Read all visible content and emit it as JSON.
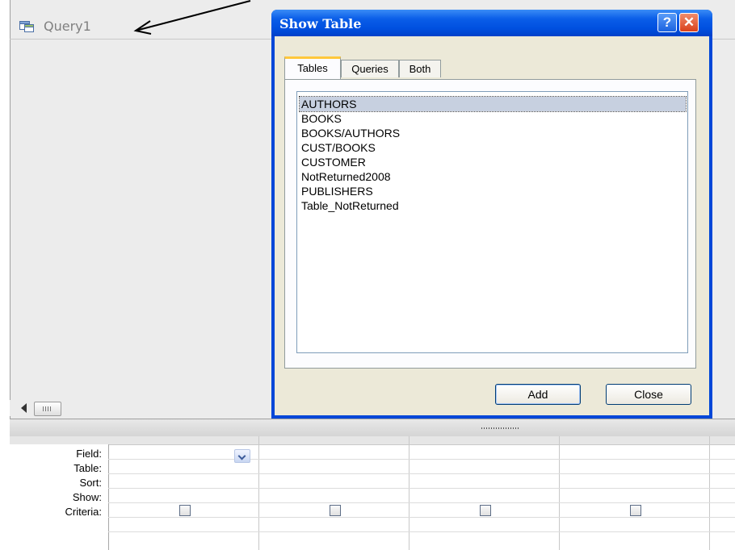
{
  "query_tab": {
    "title": "Query1",
    "icon": "query-table-icon"
  },
  "dialog": {
    "title": "Show Table",
    "help_label": "?",
    "close_label": "✕",
    "tabs": [
      {
        "label": "Tables",
        "active": true
      },
      {
        "label": "Queries",
        "active": false
      },
      {
        "label": "Both",
        "active": false
      }
    ],
    "tables": [
      "AUTHORS",
      "BOOKS",
      "BOOKS/AUTHORS",
      "CUST/BOOKS",
      "CUSTOMER",
      "NotReturned2008",
      "PUBLISHERS",
      "Table_NotReturned"
    ],
    "selected_table": "AUTHORS",
    "add_button": "Add",
    "close_button": "Close"
  },
  "design_grid": {
    "row_labels": [
      "Field:",
      "Table:",
      "Sort:",
      "Show:",
      "Criteria:"
    ]
  },
  "colors": {
    "title_bar": "#0050e0",
    "selection": "#c7d0e0",
    "active_tab_accent": "#ffc83c"
  }
}
